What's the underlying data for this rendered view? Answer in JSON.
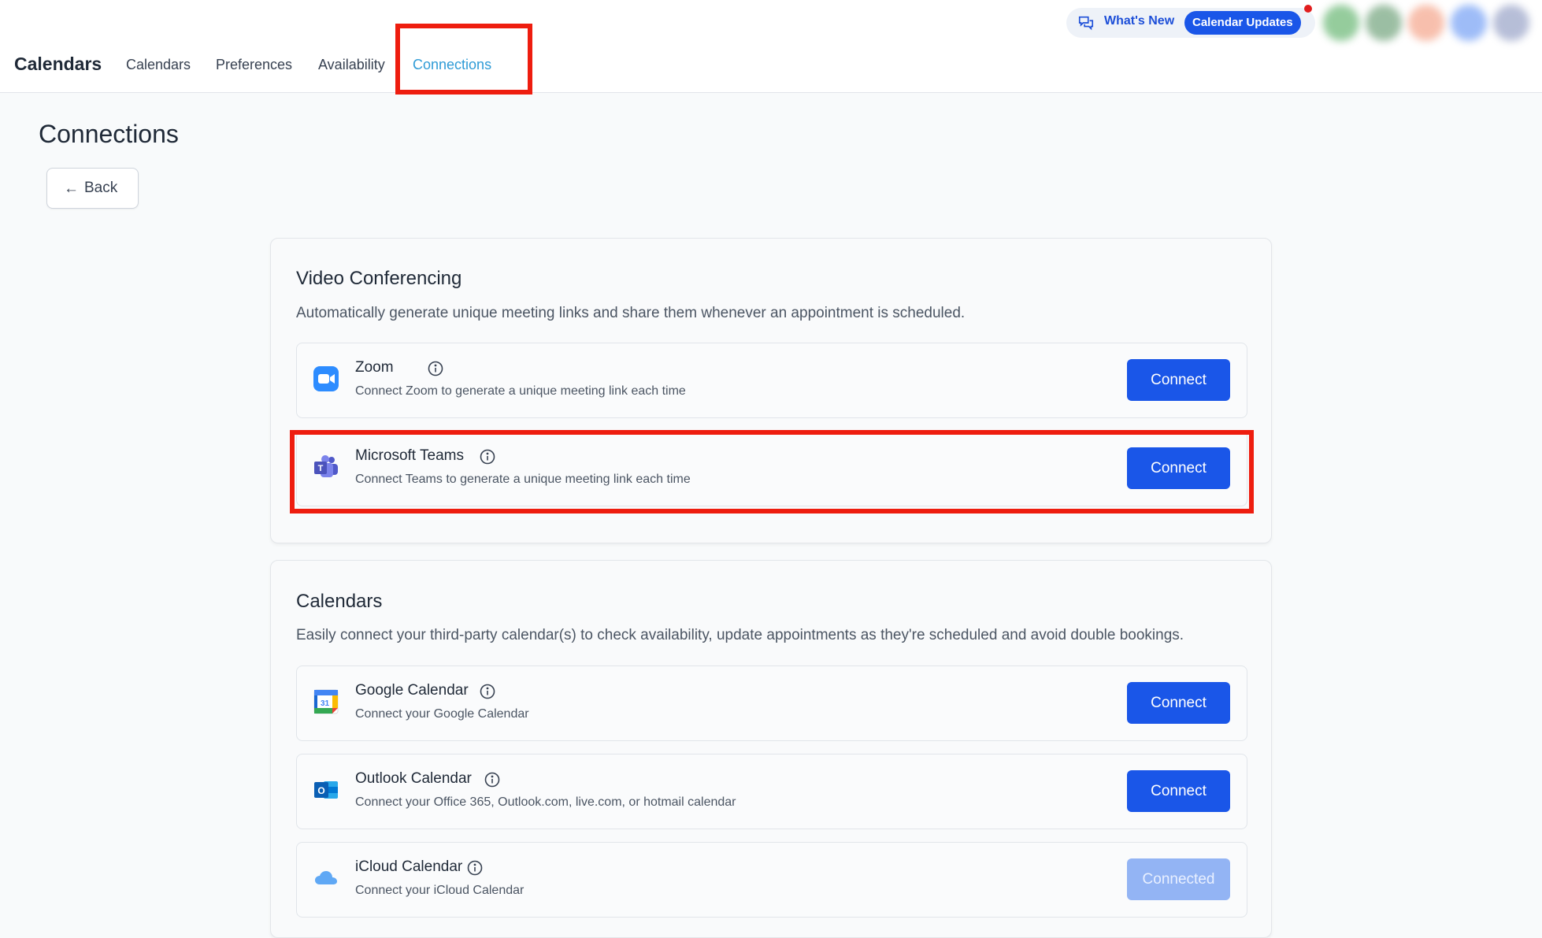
{
  "header": {
    "app_title": "Calendars",
    "tabs": [
      {
        "label": "Calendars"
      },
      {
        "label": "Preferences"
      },
      {
        "label": "Availability"
      },
      {
        "label": "Connections",
        "active": true
      }
    ],
    "whats_new": "What's New",
    "calendar_updates": "Calendar Updates"
  },
  "page": {
    "title": "Connections",
    "back_label": "Back"
  },
  "video": {
    "title": "Video Conferencing",
    "description": "Automatically generate unique meeting links and share them whenever an appointment is scheduled.",
    "items": [
      {
        "name": "Zoom",
        "sub": "Connect Zoom to generate a unique meeting link each time",
        "button": "Connect",
        "icon": "zoom-icon"
      },
      {
        "name": "Microsoft Teams",
        "sub": "Connect Teams to generate a unique meeting link each time",
        "button": "Connect",
        "icon": "microsoft-teams-icon"
      }
    ]
  },
  "calendars": {
    "title": "Calendars",
    "description": "Easily connect your third-party calendar(s) to check availability, update appointments as they're scheduled and avoid double bookings.",
    "items": [
      {
        "name": "Google Calendar",
        "sub": "Connect your Google Calendar",
        "button": "Connect",
        "icon": "google-calendar-icon"
      },
      {
        "name": "Outlook Calendar",
        "sub": "Connect your Office 365, Outlook.com, live.com, or hotmail calendar",
        "button": "Connect",
        "icon": "outlook-icon"
      },
      {
        "name": "iCloud Calendar",
        "sub": "Connect your iCloud Calendar",
        "button": "Connected",
        "icon": "icloud-icon"
      }
    ]
  },
  "colors": {
    "primary": "#1a56e8",
    "active_tab": "#2f9bd6",
    "highlight": "#ee1d0f"
  }
}
